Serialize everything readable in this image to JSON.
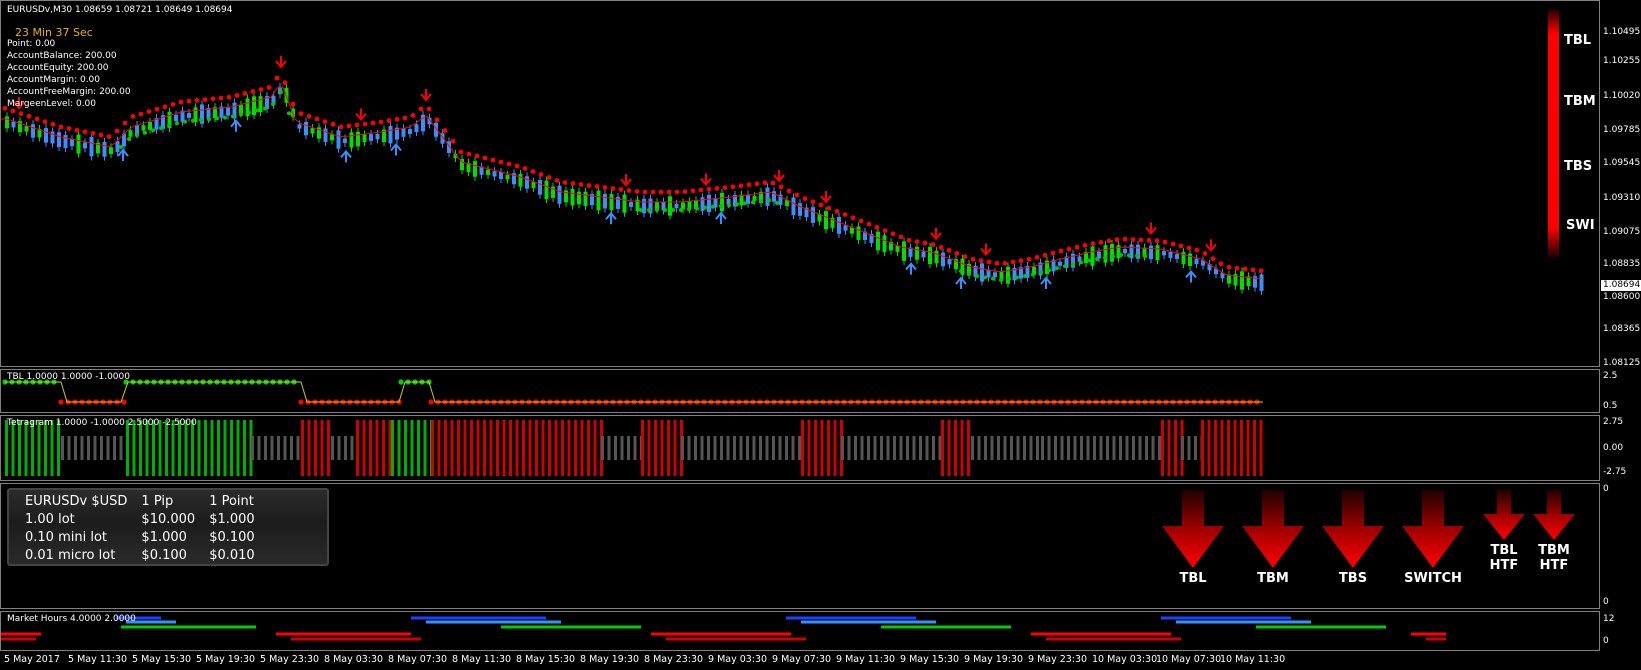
{
  "main": {
    "symbol_line": "EURUSDv,M30  1.08659 1.08721 1.08649 1.08694",
    "timer": "23 Min 37 Sec",
    "account": [
      "Point: 0.00",
      "AccountBalance: 200.00",
      "AccountEquity: 200.00",
      "AccountMargin: 0.00",
      "AccountFreeMargin: 200.00",
      "MargeenLevel: 0.00"
    ],
    "price_axis": [
      "1.10495",
      "1.10255",
      "1.10020",
      "1.09785",
      "1.09545",
      "1.09310",
      "1.09075",
      "1.08835",
      "1.08600",
      "1.08365",
      "1.08125"
    ],
    "current_price": "1.08694",
    "side_labels": [
      "TBL",
      "TBM",
      "TBS",
      "SWI"
    ]
  },
  "tbl": {
    "title": "TBL 1.0000 1.0000 -1.0000",
    "axis": [
      "2.5",
      "0.5"
    ]
  },
  "tetragram": {
    "title": "Tetragram 1.0000 -1.0000 2.5000 -2.5000",
    "axis": [
      "2.75",
      "0.00",
      "-2.75"
    ]
  },
  "info": {
    "rows": [
      [
        "EURUSDv $USD",
        "1 Pip",
        "1 Point"
      ],
      [
        "1.00 lot",
        "$10.000",
        "$1.000"
      ],
      [
        "0.10 mini lot",
        "$1.000",
        "$0.100"
      ],
      [
        "0.01 micro lot",
        "$0.100",
        "$0.010"
      ]
    ],
    "axis": [
      "0",
      "0"
    ],
    "signals": [
      "TBL",
      "TBM",
      "TBS",
      "SWITCH"
    ],
    "htf_signals": [
      [
        "TBL",
        "HTF"
      ],
      [
        "TBM",
        "HTF"
      ]
    ]
  },
  "market_hours": {
    "title": "Market Hours 4.0000 2.0000",
    "axis": [
      "12",
      "0"
    ]
  },
  "time_axis": [
    "5 May 2017",
    "5 May 11:30",
    "5 May 15:30",
    "5 May 19:30",
    "5 May 23:30",
    "8 May 03:30",
    "8 May 07:30",
    "8 May 11:30",
    "8 May 15:30",
    "8 May 19:30",
    "8 May 23:30",
    "9 May 03:30",
    "9 May 07:30",
    "9 May 11:30",
    "9 May 15:30",
    "9 May 19:30",
    "9 May 23:30",
    "10 May 03:30",
    "10 May 07:30",
    "10 May 11:30"
  ],
  "colors": {
    "bull": "#00e000",
    "bear": "#3a8fff",
    "red": "#ff0000",
    "green": "#00c800",
    "grey": "#555555"
  }
}
